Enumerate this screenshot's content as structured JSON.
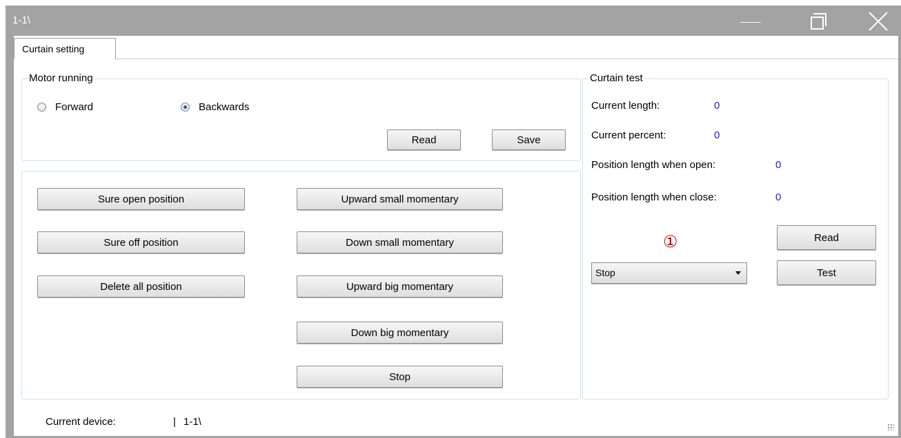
{
  "window": {
    "title": "1-1\\"
  },
  "tabs": [
    {
      "label": "Curtain setting"
    }
  ],
  "motor_running": {
    "title": "Motor running",
    "options": [
      {
        "label": "Forward",
        "selected": false
      },
      {
        "label": "Backwards",
        "selected": true
      }
    ],
    "read_label": "Read",
    "save_label": "Save"
  },
  "positions": {
    "left_buttons": [
      "Sure open position",
      "Sure off position",
      "Delete all position"
    ],
    "right_buttons": [
      "Upward small momentary",
      "Down small momentary",
      "Upward big momentary",
      "Down big momentary",
      "Stop"
    ]
  },
  "curtain_test": {
    "title": "Curtain test",
    "current_length_label": "Current length:",
    "current_length_value": "0",
    "current_percent_label": "Current percent:",
    "current_percent_value": "0",
    "open_length_label": "Position length when open:",
    "open_length_value": "0",
    "close_length_label": "Position length when close:",
    "close_length_value": "0",
    "marker": "①",
    "mode_select": "Stop",
    "read_label": "Read",
    "test_label": "Test"
  },
  "status": {
    "current_device_label": "Current device:",
    "separator": "|",
    "current_device_value": "1-1\\"
  },
  "colors": {
    "titlebar": "#a3a3a3",
    "value_text": "#1a1ae6",
    "marker": "#c00000"
  }
}
